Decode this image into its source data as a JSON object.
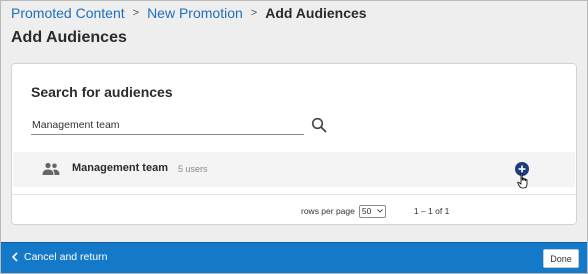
{
  "breadcrumb": {
    "items": [
      {
        "label": "Promoted Content"
      },
      {
        "label": "New Promotion"
      },
      {
        "label": "Add Audiences"
      }
    ],
    "separator": ">"
  },
  "page": {
    "title": "Add Audiences"
  },
  "search": {
    "heading": "Search for audiences",
    "value": "Management team",
    "icon": "search-icon"
  },
  "results": [
    {
      "name": "Management team",
      "count": "5 users",
      "icon": "group-icon",
      "action_icon": "add-circle-icon"
    }
  ],
  "pagination": {
    "rows_label": "rows per page",
    "rows_value": "50",
    "range": "1 – 1 of 1"
  },
  "footer": {
    "cancel_label": "Cancel and return",
    "done_label": "Done"
  },
  "colors": {
    "link": "#1f6fb8",
    "footer_bg": "#1479c9",
    "add_button": "#1c3d7a",
    "page_bg": "#eeeeee"
  }
}
